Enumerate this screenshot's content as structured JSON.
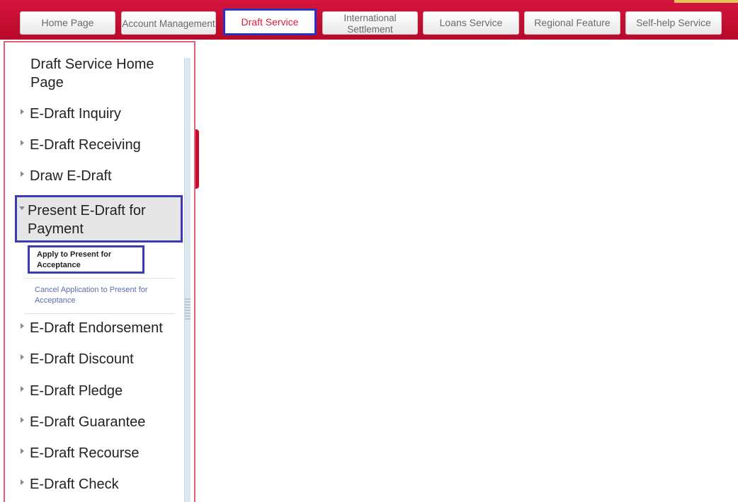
{
  "nav": {
    "tabs": [
      {
        "label": "Home Page"
      },
      {
        "label": "Account Management"
      },
      {
        "label": "Draft Service"
      },
      {
        "label": "International Settlement"
      },
      {
        "label": "Loans Service"
      },
      {
        "label": "Regional Feature"
      },
      {
        "label": "Self-help Service"
      }
    ],
    "active_index": 2
  },
  "sidebar": {
    "home_label": "Draft Service Home Page",
    "items": [
      {
        "label": "E-Draft Inquiry"
      },
      {
        "label": "E-Draft Receiving"
      },
      {
        "label": "Draw E-Draft"
      },
      {
        "label": "Present E-Draft for Payment"
      },
      {
        "label": "E-Draft Endorsement"
      },
      {
        "label": "E-Draft Discount"
      },
      {
        "label": "E-Draft Pledge"
      },
      {
        "label": "E-Draft Guarantee"
      },
      {
        "label": "E-Draft Recourse"
      },
      {
        "label": "E-Draft Check"
      }
    ],
    "submenu": [
      {
        "label": "Apply to Present for Acceptance"
      },
      {
        "label": "Cancel Application to Present for Acceptance"
      }
    ]
  },
  "colors": {
    "brand_red": "#c40d31",
    "highlight_blue": "#3b3bb8",
    "submenu_link": "#5a6bb0"
  }
}
